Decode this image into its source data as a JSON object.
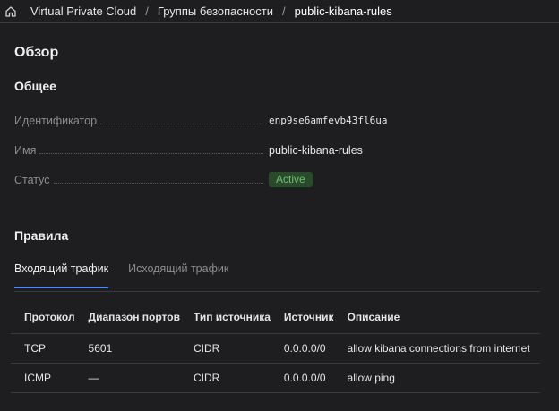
{
  "breadcrumb": {
    "items": [
      "Virtual Private Cloud",
      "Группы безопасности",
      "public-kibana-rules"
    ],
    "separator": "/",
    "home_icon": "home-icon"
  },
  "overview": {
    "title": "Обзор",
    "general_title": "Общее",
    "properties": [
      {
        "label": "Идентификатор",
        "value": "enp9se6amfevb43fl6ua"
      },
      {
        "label": "Имя",
        "value": "public-kibana-rules"
      },
      {
        "label": "Статус",
        "value": "Active"
      }
    ],
    "status_color": "#6cc070"
  },
  "rules": {
    "title": "Правила",
    "tabs": [
      {
        "label": "Входящий трафик",
        "active": true
      },
      {
        "label": "Исходящий трафик",
        "active": false
      }
    ],
    "columns": [
      "Протокол",
      "Диапазон портов",
      "Тип источника",
      "Источник",
      "Описание"
    ],
    "rows": [
      [
        "TCP",
        "5601",
        "CIDR",
        "0.0.0.0/0",
        "allow kibana connections from internet"
      ],
      [
        "ICMP",
        "—",
        "CIDR",
        "0.0.0.0/0",
        "allow ping"
      ]
    ]
  },
  "colors": {
    "background": "#1e1e21",
    "accent": "#4d8cf5"
  }
}
